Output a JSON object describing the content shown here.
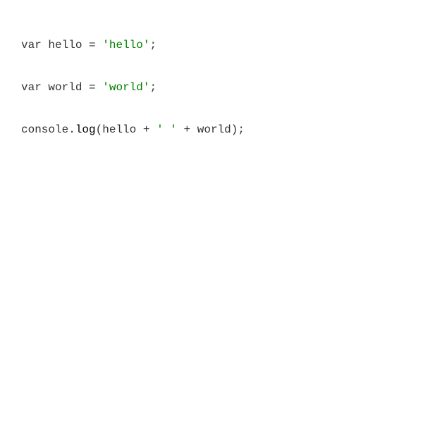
{
  "code": {
    "line1": {
      "kw": "var",
      "name": "hello",
      "op": "=",
      "str": "'hello'",
      "end": ";"
    },
    "line2": {
      "kw": "var",
      "name": "world",
      "op": "=",
      "str": "'world'",
      "end": ";"
    },
    "line3": {
      "obj": "console",
      "dot": ".",
      "method": "log",
      "open": "(",
      "arg1": "hello",
      "plus1": "+",
      "str": "' '",
      "plus2": "+",
      "arg2": "world",
      "close": ");"
    }
  },
  "colors": {
    "text": "#333333",
    "string": "#008000",
    "method": "#000000",
    "background": "#ffffff"
  }
}
